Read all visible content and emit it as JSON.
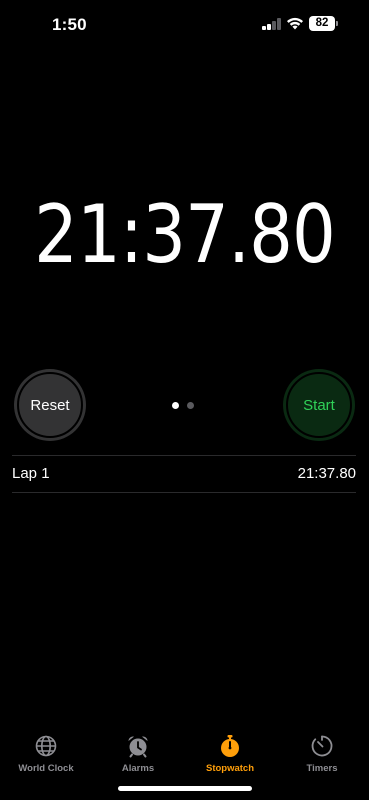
{
  "status_bar": {
    "time": "1:50",
    "battery_level": "82",
    "signal_bars_active": 2,
    "signal_bars_total": 4
  },
  "stopwatch": {
    "elapsed_time": "21:37.80",
    "reset_label": "Reset",
    "start_label": "Start",
    "page_count": 2,
    "current_page": 1
  },
  "laps": [
    {
      "label": "Lap 1",
      "time": "21:37.80"
    }
  ],
  "tab_bar": {
    "tabs": [
      {
        "label": "World Clock",
        "icon": "globe-icon",
        "active": false
      },
      {
        "label": "Alarms",
        "icon": "alarm-clock-icon",
        "active": false
      },
      {
        "label": "Stopwatch",
        "icon": "stopwatch-icon",
        "active": true
      },
      {
        "label": "Timers",
        "icon": "timer-icon",
        "active": false
      }
    ]
  },
  "colors": {
    "background": "#000000",
    "accent": "#ff9f0a",
    "start_green": "#30d158",
    "inactive_tab": "#8e8e93"
  }
}
